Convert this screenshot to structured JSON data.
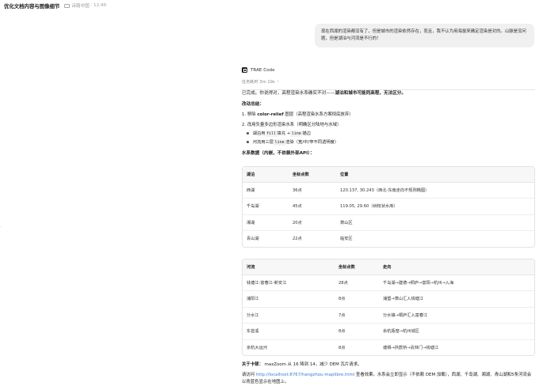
{
  "header": {
    "title": "优化文档内容与图像细节",
    "workspace": "诗路中国",
    "time": "12:40"
  },
  "side_mark": "․",
  "user_message": "现在西湖的渲染都没有了，但是城市的渲染依然存在，而且，我不认为用海拔来确定渲染是对的。山脉是没问题，但是湖泊与河流是不行的！",
  "agent": {
    "name": "TRAE Code",
    "duration": "任务耗时 3m 19s",
    "intro_plain": "已完成。你说得对，高程渲染水系确实不对——",
    "intro_bold": "湖泊和城市可能同高程，无法区分。",
    "changes_title": "改动总结：",
    "change1_prefix": "1. 移除 ",
    "change1_bold": "color-relief",
    "change1_suffix": " 图层（高程渲染水系方案彻底放弃）",
    "change2": "2. 改用矢量多边形渲染水系（明确区分陆地与水域）",
    "sub1_a": "湖泊用 ",
    "sub1_code1": "fill",
    "sub1_b": " 填充 + ",
    "sub1_code2": "line",
    "sub1_c": " 描边",
    "sub2_a": "河流用三层 ",
    "sub2_code": "line",
    "sub2_b": " 渲染（宽/中/窄不同透明度）",
    "data_title": "水系数据（内嵌，不依赖外部API）："
  },
  "lakes_table": {
    "headers": [
      "湖泊",
      "坐标点数",
      "位置"
    ],
    "rows": [
      [
        "西湖",
        "36点",
        "120.137, 30.243（西北-东南走向不规则椭圆）"
      ],
      [
        "千岛湖",
        "45点",
        "119.05, 29.60（树枝状水库）"
      ],
      [
        "湘湖",
        "20点",
        "萧山区"
      ],
      [
        "青山湖",
        "22点",
        "临安区"
      ]
    ]
  },
  "rivers_table": {
    "headers": [
      "河流",
      "坐标点数",
      "走向"
    ],
    "rows": [
      [
        "钱塘江-富春江-新安江",
        "28点",
        "千岛湖→建德→桐庐→富阳→杭州→入海"
      ],
      [
        "浦阳江",
        "8点",
        "浦暨→萧山汇入钱塘江"
      ],
      [
        "分水江",
        "7点",
        "分水镇→桐庐汇入富春江"
      ],
      [
        "东苕溪",
        "8点",
        "余杭瓶窑→杭州城区"
      ],
      [
        "京杭大运河",
        "8点",
        "塘栖→拱宸桥→武林门→钱塘江"
      ]
    ]
  },
  "note_bold": "关于卡顿：",
  "note_text": " maxZoom 从 16 降到 14，减少 DEM 瓦片请求。",
  "visit_prefix": "请访问 ",
  "visit_link": "http://localhost:8767/hangzhou-maplibre.html",
  "visit_suffix": " 查看效果。水系会立即显示（不依赖 DEM 加载），西湖、千岛湖、湘湖、青山湖和5条河流会以青蓝色显示在地图上。"
}
